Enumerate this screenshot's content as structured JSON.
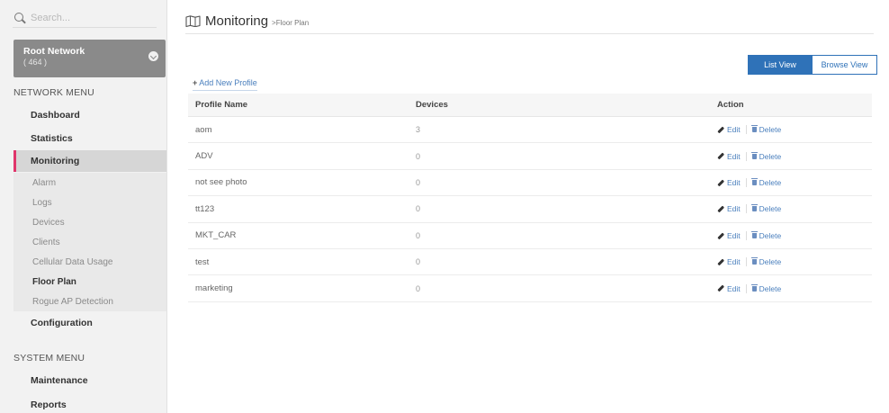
{
  "search": {
    "placeholder": "Search..."
  },
  "network": {
    "name": "Root Network",
    "count": "( 464 )"
  },
  "sidebar": {
    "network_menu_title": "NETWORK MENU",
    "items": {
      "dashboard": "Dashboard",
      "statistics": "Statistics",
      "monitoring": "Monitoring",
      "alarm": "Alarm",
      "logs": "Logs",
      "devices": "Devices",
      "clients": "Clients",
      "cellular": "Cellular Data Usage",
      "floor_plan": "Floor Plan",
      "rogue": "Rogue AP Detection",
      "configuration": "Configuration",
      "maintenance": "Maintenance",
      "reports": "Reports"
    },
    "system_menu_title": "SYSTEM MENU"
  },
  "header": {
    "title": "Monitoring",
    "breadcrumb": ">Floor Plan"
  },
  "view_toggle": {
    "list": "List View",
    "browse": "Browse View"
  },
  "add_profile": {
    "plus": "+",
    "label": "Add New Profile"
  },
  "table": {
    "headers": {
      "name": "Profile Name",
      "devices": "Devices",
      "action": "Action"
    },
    "edit_label": "Edit",
    "delete_label": "Delete",
    "rows": [
      {
        "name": "aom",
        "devices": "3"
      },
      {
        "name": "ADV",
        "devices": "0"
      },
      {
        "name": "not see photo",
        "devices": "0"
      },
      {
        "name": "tt123",
        "devices": "0"
      },
      {
        "name": "MKT_CAR",
        "devices": "0"
      },
      {
        "name": "test",
        "devices": "0"
      },
      {
        "name": "marketing",
        "devices": "0"
      }
    ]
  },
  "colors": {
    "accent": "#2f72b8",
    "active_marker": "#e0366b",
    "link": "#4a7fbd"
  }
}
